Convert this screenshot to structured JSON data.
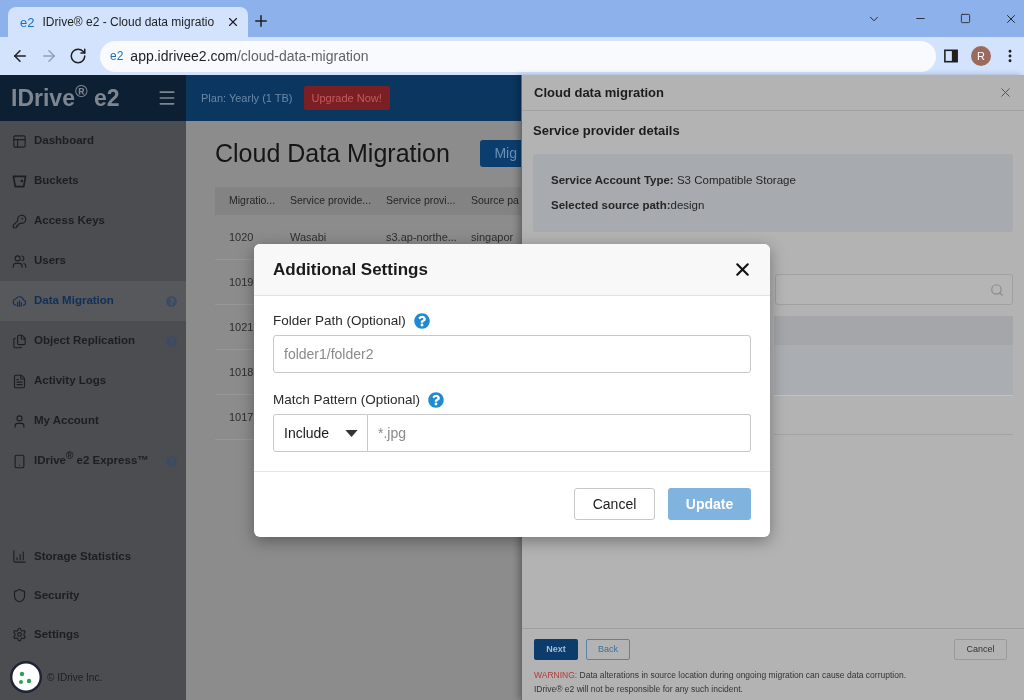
{
  "browser": {
    "tab": {
      "favicon": "e2",
      "title": "IDrive® e2 - Cloud data migratio",
      "selected": true
    },
    "nav": [
      {
        "kind": "back",
        "disabled": false
      },
      {
        "kind": "forward",
        "disabled": true
      },
      {
        "kind": "reload",
        "disabled": false
      }
    ],
    "address_bar": {
      "site_icon": "e2",
      "host": "app.idrivee2.com",
      "path": "/cloud-data-migration"
    },
    "profile": {
      "initial": "R"
    }
  },
  "sidebar": {
    "logo": "IDrive$^{®}$ e2",
    "items": [
      {
        "label": "Dashboard",
        "selected": false,
        "help": false
      },
      {
        "label": "Buckets",
        "selected": false,
        "help": false
      },
      {
        "label": "Access Keys",
        "selected": false,
        "help": false
      },
      {
        "label": "Users",
        "selected": false,
        "help": false
      },
      {
        "label": "Data Migration",
        "selected": true,
        "help": true
      },
      {
        "label": "Object Replication",
        "selected": false,
        "help": true
      },
      {
        "label": "Activity Logs",
        "selected": false,
        "help": false
      },
      {
        "label": "My Account",
        "selected": false,
        "help": false
      },
      {
        "label": "IDrive$^{®}$ e2 Express™",
        "selected": false,
        "help": true
      }
    ],
    "bottom_items": [
      {
        "label": "Storage Statistics",
        "selected": false
      },
      {
        "label": "Security",
        "selected": false
      },
      {
        "label": "Settings",
        "selected": false
      }
    ],
    "footer": "© IDrive Inc."
  },
  "header": {
    "plan": "Plan: Yearly (1 TB)",
    "upgrade_button": "Upgrade Now!"
  },
  "page": {
    "title": "Cloud Data Migration",
    "action_button": "Mig",
    "table": {
      "columns": [
        "Migratio...",
        "Service provide...",
        "Service provi...",
        "Source pa"
      ],
      "rows": [
        {
          "cells": [
            "1020",
            "Wasabi",
            "s3.ap-northe...",
            "singapor"
          ]
        },
        {
          "cells": [
            "1019"
          ]
        },
        {
          "cells": [
            "1021"
          ]
        },
        {
          "cells": [
            "1018"
          ]
        },
        {
          "cells": [
            "1017"
          ]
        }
      ]
    }
  },
  "drawer": {
    "title": "Cloud data migration",
    "section_title": "Service provider details",
    "details": [
      "**Service Account Type:** S3 Compatible Storage",
      "**Selected source path:**design"
    ],
    "buttons": [
      {
        "label": "Next",
        "kind": "primary"
      },
      {
        "label": "Back",
        "kind": "outline"
      }
    ],
    "cancel_button": "Cancel",
    "warning": {
      "label": "WARNING:",
      "text": "Data alterations in source location during ongoing migration can cause data corruption."
    },
    "disclaimer": "IDrive® e2 will not be responsible for any such incident."
  },
  "modal": {
    "title": "Additional Settings",
    "fields": [
      {
        "kind": "text",
        "label": "Folder Path (Optional)",
        "help": true,
        "placeholder": "folder1/folder2"
      },
      {
        "kind": "pattern",
        "label": "Match Pattern (Optional)",
        "help": true,
        "mode": "Include",
        "placeholder": "*.jpg"
      }
    ],
    "buttons": [
      {
        "label": "Cancel",
        "kind": "secondary",
        "disabled": false
      },
      {
        "label": "Update",
        "kind": "primary",
        "disabled": true
      }
    ]
  }
}
